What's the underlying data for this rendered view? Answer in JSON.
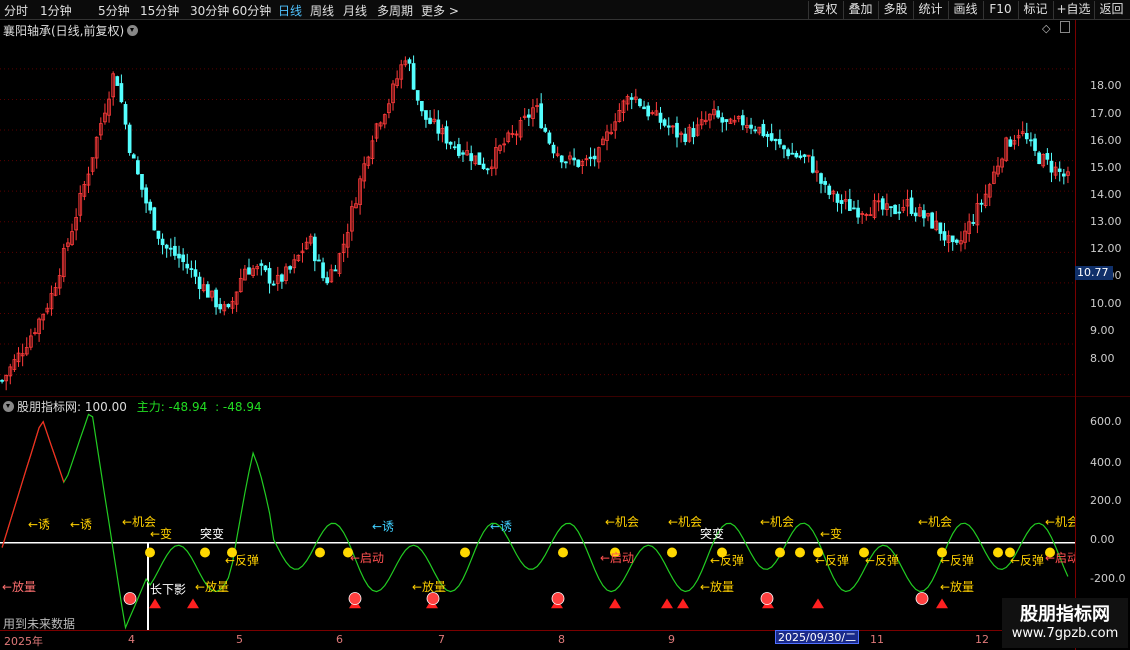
{
  "toolbar": {
    "periods": [
      "分时",
      "1分钟",
      "5分钟",
      "15分钟",
      "30分钟",
      "60分钟",
      "日线",
      "周线",
      "月线",
      "多周期",
      "更多 >"
    ],
    "active_period": "日线",
    "actions": [
      "复权",
      "叠加",
      "多股",
      "统计",
      "画线",
      "F10",
      "标记",
      "+自选",
      "返回"
    ]
  },
  "main_panel": {
    "title": "襄阳轴承(日线,前复权)",
    "y_ticks": [
      "18.00",
      "17.00",
      "16.00",
      "15.00",
      "14.00",
      "13.00",
      "12.00",
      "11.00",
      "10.00",
      "9.00",
      "8.00"
    ],
    "current_price": "10.77"
  },
  "sub_panel": {
    "name": "股朋指标网",
    "param": ": 100.00",
    "main_force": "主力: -48.94",
    "extra": ": -48.94",
    "y_ticks": [
      "600.0",
      "400.0",
      "200.0",
      "0.00",
      "-200.0"
    ],
    "future_note": "用到未来数据",
    "signal_labels": [
      "←机会",
      "←诱",
      "突变",
      "←反弹",
      "←放量",
      "←启动",
      "长下影",
      "←变"
    ]
  },
  "x_axis": {
    "labels": [
      "2025年",
      "4",
      "5",
      "6",
      "7",
      "8",
      "9",
      "10",
      "11",
      "12"
    ],
    "cursor_date": "2025/09/30/二"
  },
  "watermark": {
    "title": "股朋指标网",
    "url": "www.7gpzb.com"
  },
  "colors": {
    "up": "#ff3b3b",
    "down": "#54ffff",
    "line": "#22cc22",
    "red_line": "#ff2222",
    "signal_yellow": "#ffd800"
  },
  "chart_data": {
    "type": "candlestick",
    "title": "襄阳轴承(日线,前复权)",
    "ylim": [
      7.3,
      19.6
    ],
    "close_series_approx": [
      7.8,
      8.6,
      9.5,
      10.5,
      12.2,
      14.0,
      16.0,
      18.0,
      15.2,
      13.5,
      12.2,
      11.8,
      11.2,
      10.5,
      10.0,
      11.5,
      11.4,
      11.0,
      11.5,
      12.5,
      11.0,
      12.0,
      14.0,
      16.0,
      17.0,
      18.5,
      16.5,
      16.0,
      15.5,
      15.2,
      14.8,
      15.5,
      16.0,
      16.8,
      15.5,
      15.0,
      14.9,
      15.2,
      16.5,
      17.2,
      16.6,
      16.2,
      15.8,
      16.0,
      16.5,
      16.1,
      16.3,
      16.0,
      15.5,
      15.2,
      15.0,
      14.0,
      13.6,
      13.4,
      13.5,
      13.3,
      13.6,
      13.2,
      12.8,
      12.0,
      13.0,
      14.0,
      15.4,
      16.0,
      15.2,
      14.8,
      14.4
    ]
  }
}
